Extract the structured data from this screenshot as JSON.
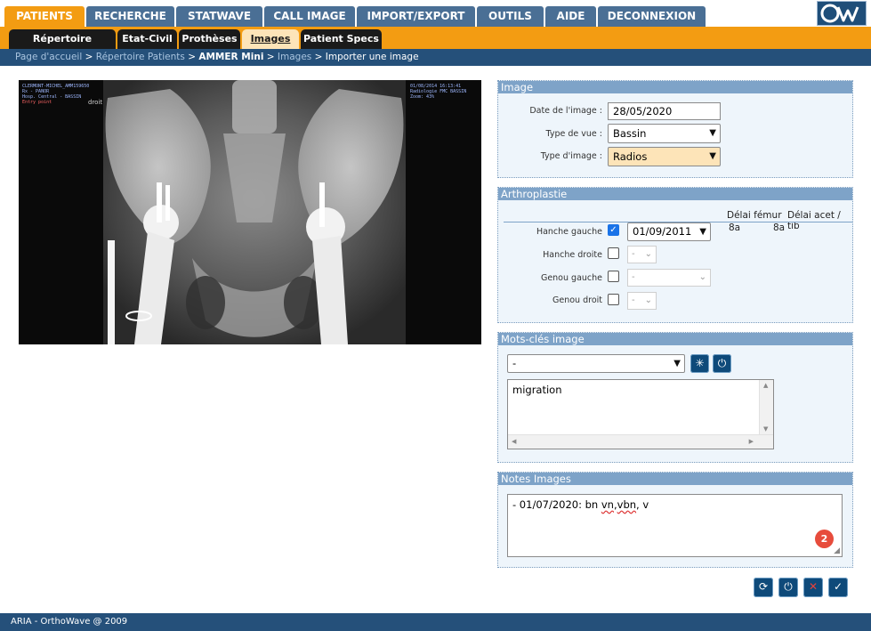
{
  "top_tabs": [
    {
      "label": "PATIENTS",
      "active": true
    },
    {
      "label": "RECHERCHE",
      "active": false
    },
    {
      "label": "STATWAVE",
      "active": false
    },
    {
      "label": "CALL IMAGE",
      "active": false
    },
    {
      "label": "IMPORT/EXPORT",
      "active": false
    },
    {
      "label": "OUTILS",
      "active": false
    },
    {
      "label": "AIDE",
      "active": false
    },
    {
      "label": "DECONNEXION",
      "active": false
    }
  ],
  "sub_tabs": [
    {
      "label": "Répertoire Patients",
      "active": false
    },
    {
      "label": "Etat-Civil",
      "active": false
    },
    {
      "label": "Prothèses",
      "active": false
    },
    {
      "label": "Images",
      "active": true
    },
    {
      "label": "Patient Specs",
      "active": false
    }
  ],
  "breadcrumb": {
    "home": "Page d'accueil",
    "repertoire": "Répertoire Patients",
    "patient": "AMMER Mini",
    "images": "Images",
    "current": "Importer une image",
    "separator": ">"
  },
  "xray": {
    "side_label": "droit",
    "status_text": "Entry point"
  },
  "image_panel": {
    "title": "Image",
    "date_label": "Date de l'image :",
    "date_value": "28/05/2020",
    "view_label": "Type de vue :",
    "view_value": "Bassin",
    "kind_label": "Type d'image :",
    "kind_value": "Radios"
  },
  "arthro_panel": {
    "title": "Arthroplastie",
    "col_femur": "Délai fémur",
    "col_acet": "Délai acet / tib",
    "rows": [
      {
        "label": "Hanche gauche",
        "checked": true,
        "date": "01/09/2011",
        "femur": "8a",
        "acet": "8a"
      },
      {
        "label": "Hanche droite",
        "checked": false,
        "date": "-"
      },
      {
        "label": "Genou gauche",
        "checked": false,
        "date": "-"
      },
      {
        "label": "Genou droit",
        "checked": false,
        "date": "-"
      }
    ]
  },
  "keywords_panel": {
    "title": "Mots-clés image",
    "select_value": "-",
    "text": "migration"
  },
  "notes_panel": {
    "title": "Notes Images",
    "text_prefix": "- 01/07/2020: bn ",
    "text_word1": "vn",
    "text_comma": ",",
    "text_word2": "vbn",
    "text_suffix": ", v",
    "badge_count": "2"
  },
  "footer": {
    "text": "ARIA - OrthoWave @ 2009"
  },
  "colors": {
    "active_tab": "#f39c12",
    "tab": "#4a6f95",
    "nav_dark": "#25507a",
    "panel_header": "#7ea3c8",
    "panel_bg": "#eef5fb",
    "highlight_select": "#fde4b8",
    "badge": "#e74c3c"
  }
}
